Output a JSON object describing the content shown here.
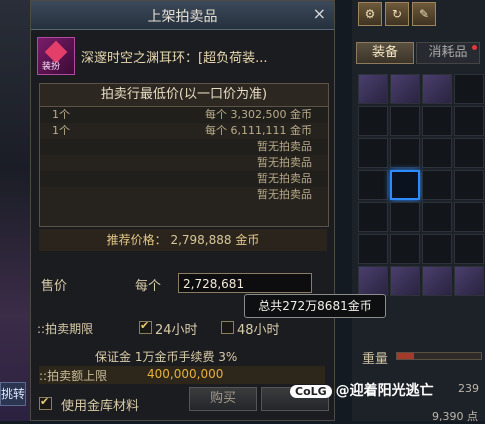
{
  "left_edge": {
    "label": "挑转"
  },
  "dialog": {
    "title": "上架拍卖品",
    "close_glyph": "×",
    "item": {
      "name": "深邃时空之渊耳环：[超负荷装...",
      "icon_tag": "装扮"
    },
    "lowest_price": {
      "header": "拍卖行最低价(以一口价为准)",
      "rows": [
        {
          "qty": "1个",
          "price": "每个 3,302,500 金币"
        },
        {
          "qty": "1个",
          "price": "每个 6,111,111 金币"
        },
        {
          "none": "暂无拍卖品"
        },
        {
          "none": "暂无拍卖品"
        },
        {
          "none": "暂无拍卖品"
        },
        {
          "none": "暂无拍卖品"
        }
      ]
    },
    "recommend": {
      "label": "推荐价格：",
      "value": "2,798,888",
      "unit": "金币"
    },
    "sell_price": {
      "label": "售价",
      "each_label": "每个",
      "value": "2,728,681"
    },
    "tooltip": "总共272万8681金币",
    "period": {
      "label": "::拍卖期限",
      "options": [
        {
          "label": "24小时",
          "checked": true
        },
        {
          "label": "48小时",
          "checked": false
        }
      ]
    },
    "deposit": "保证金 1万金币手续费 3%",
    "limit": {
      "label": "::拍卖额上限",
      "value": "400,000,000"
    },
    "use_vault": {
      "label": "使用金库材料",
      "checked": true
    },
    "buttons": {
      "register": "购买",
      "cancel": ""
    }
  },
  "inventory": {
    "tools": [
      "⚙",
      "↻",
      "✎"
    ],
    "tabs": [
      {
        "label": "装备",
        "active": true
      },
      {
        "label": "消耗品",
        "active": false
      }
    ],
    "weight_label": "重量",
    "weight_fraction": 0.2,
    "gold_label": "239",
    "gold_label2": "9,390 点"
  },
  "watermark": {
    "logo": "CoLG",
    "text": "@迎着阳光逃亡"
  }
}
